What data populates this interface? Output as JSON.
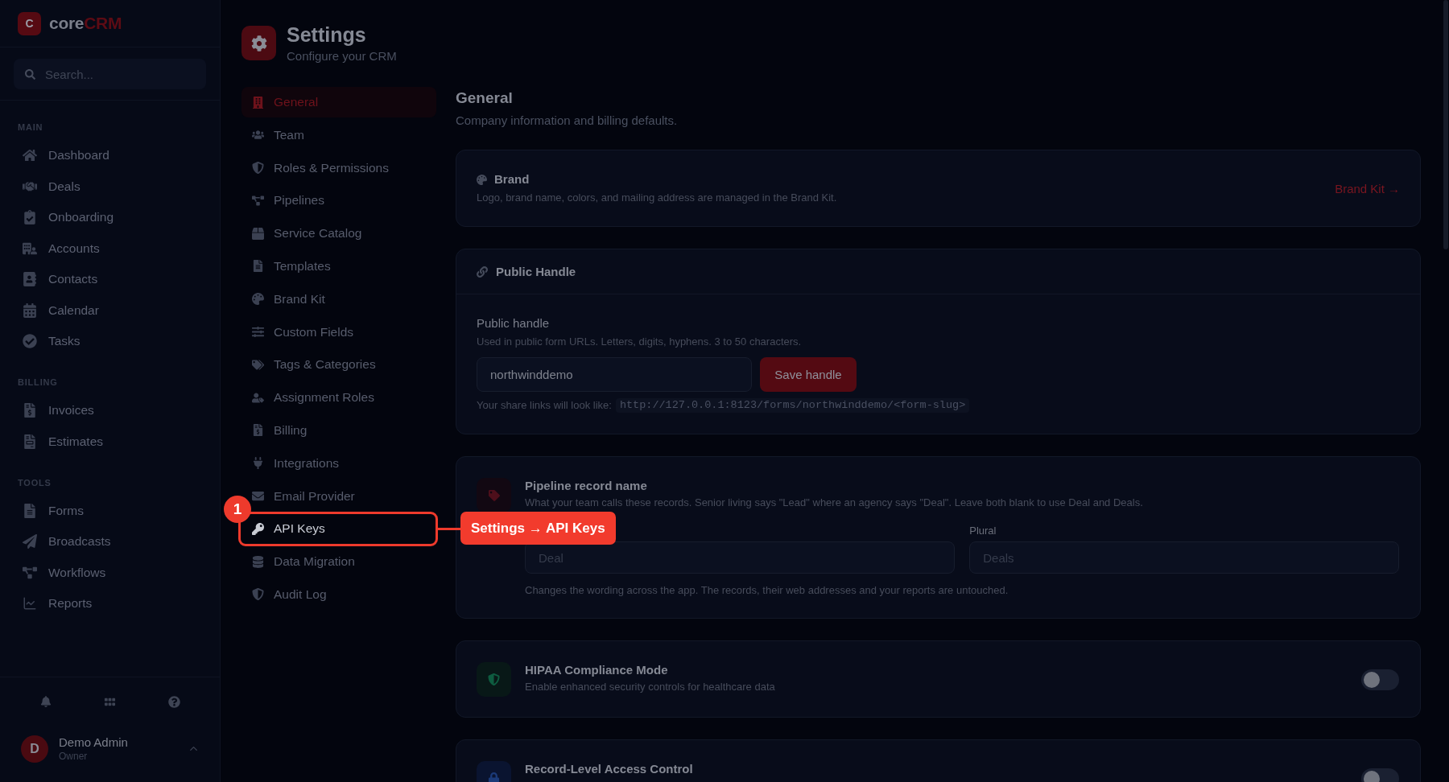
{
  "sidebar": {
    "logo": {
      "letter": "C",
      "name": "core",
      "accent": "CRM"
    },
    "search": {
      "placeholder": "Search..."
    },
    "sections": [
      {
        "label": "MAIN",
        "items": [
          {
            "label": "Dashboard"
          },
          {
            "label": "Deals"
          },
          {
            "label": "Onboarding"
          },
          {
            "label": "Accounts"
          },
          {
            "label": "Contacts"
          },
          {
            "label": "Calendar"
          },
          {
            "label": "Tasks"
          }
        ]
      },
      {
        "label": "BILLING",
        "items": [
          {
            "label": "Invoices"
          },
          {
            "label": "Estimates"
          }
        ]
      },
      {
        "label": "TOOLS",
        "items": [
          {
            "label": "Forms"
          },
          {
            "label": "Broadcasts"
          },
          {
            "label": "Workflows"
          },
          {
            "label": "Reports"
          }
        ]
      }
    ],
    "user": {
      "initial": "D",
      "name": "Demo Admin",
      "role": "Owner"
    }
  },
  "settings": {
    "title": "Settings",
    "subtitle": "Configure your CRM",
    "nav": [
      {
        "label": "General",
        "selected": true,
        "spotlight": false
      },
      {
        "label": "Team",
        "selected": false,
        "spotlight": false
      },
      {
        "label": "Roles & Permissions",
        "selected": false,
        "spotlight": false
      },
      {
        "label": "Pipelines",
        "selected": false,
        "spotlight": false
      },
      {
        "label": "Service Catalog",
        "selected": false,
        "spotlight": false
      },
      {
        "label": "Templates",
        "selected": false,
        "spotlight": false
      },
      {
        "label": "Brand Kit",
        "selected": false,
        "spotlight": false
      },
      {
        "label": "Custom Fields",
        "selected": false,
        "spotlight": false
      },
      {
        "label": "Tags & Categories",
        "selected": false,
        "spotlight": false
      },
      {
        "label": "Assignment Roles",
        "selected": false,
        "spotlight": false
      },
      {
        "label": "Billing",
        "selected": false,
        "spotlight": false
      },
      {
        "label": "Integrations",
        "selected": false,
        "spotlight": false
      },
      {
        "label": "Email Provider",
        "selected": false,
        "spotlight": false
      },
      {
        "label": "API Keys",
        "selected": false,
        "spotlight": true
      },
      {
        "label": "Data Migration",
        "selected": false,
        "spotlight": false
      },
      {
        "label": "Audit Log",
        "selected": false,
        "spotlight": false
      }
    ]
  },
  "tour": {
    "step": "1",
    "callout": "Settings → API Keys"
  },
  "section": {
    "title": "General",
    "subtitle": "Company information and billing defaults."
  },
  "brand_card": {
    "title": "Brand",
    "description": "Logo, brand name, colors, and mailing address are managed in the Brand Kit.",
    "link": "Brand Kit →"
  },
  "handle_card": {
    "title": "Public Handle",
    "field_label": "Public handle",
    "hint": "Used in public form URLs. Letters, digits, hyphens. 3 to 50 characters.",
    "value": "northwinddemo",
    "button": "Save handle",
    "preview_label": "Your share links will look like:",
    "preview_url": "http://127.0.0.1:8123/forms/northwinddemo/<form-slug>"
  },
  "record_name_card": {
    "title": "Pipeline record name",
    "description": "What your team calls these records. Senior living says \"Lead\" where an agency says \"Deal\". Leave both blank to use Deal and Deals.",
    "fields": [
      {
        "placeholder": "Deal"
      },
      {
        "label": "Plural",
        "placeholder": "Deals"
      }
    ],
    "note": "Changes the wording across the app. The records, their web addresses and your reports are untouched."
  },
  "toggles": [
    {
      "title": "HIPAA Compliance Mode",
      "description": "Enable enhanced security controls for healthcare data",
      "on": false
    },
    {
      "title": "Record-Level Access Control",
      "on": false
    }
  ]
}
